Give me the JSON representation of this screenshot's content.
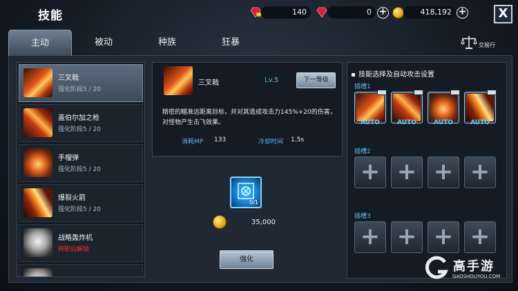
{
  "header": {
    "title": "技能",
    "resources": [
      {
        "icon": "locked-ruby-icon",
        "value": "140"
      },
      {
        "icon": "ruby-icon",
        "value": "0"
      },
      {
        "icon": "gold-coin-icon",
        "value": "418,192"
      }
    ],
    "close_label": "X"
  },
  "tabs": [
    {
      "label": "主动",
      "active": true
    },
    {
      "label": "被动",
      "active": false
    },
    {
      "label": "种族",
      "active": false
    },
    {
      "label": "狂暴",
      "active": false
    }
  ],
  "trade": {
    "label": "交易行",
    "icon": "scales-icon"
  },
  "skills": [
    {
      "name": "三叉戟",
      "stage": "强化阶段5 / 20",
      "icon": "trident-skill-icon",
      "selected": true
    },
    {
      "name": "盖伯尔加之枪",
      "stage": "强化阶段5 / 20",
      "icon": "spear-skill-icon",
      "selected": false
    },
    {
      "name": "手榴弹",
      "stage": "强化阶段5 / 20",
      "icon": "grenade-skill-icon",
      "selected": false
    },
    {
      "name": "爆裂火箭",
      "stage": "强化阶段5 / 20",
      "icon": "rocket-skill-icon",
      "selected": false
    },
    {
      "name": "战略轰炸机",
      "stage": "转职后解锁",
      "icon": "bomber-skill-icon",
      "selected": false
    }
  ],
  "detail": {
    "name": "三叉戟",
    "level": "Lv.5",
    "next_button": "下一等级",
    "description": "精密的瞄准远距离目标，并对其造成攻击力145%+20的伤害，对怪物产生击飞效果。",
    "mp_label": "消耗MP",
    "mp_value": "133",
    "cooldown_label": "冷却时间",
    "cooldown_value": "1.5s"
  },
  "upgrade": {
    "material_count": "0/1",
    "cost": "35,000",
    "button": "强化"
  },
  "slots_panel": {
    "title": "技能选择及自动攻击设置",
    "groups": [
      {
        "label": "插槽1",
        "slots": [
          {
            "filled": true,
            "auto": "AUTO"
          },
          {
            "filled": true,
            "auto": "AUTO"
          },
          {
            "filled": true,
            "auto": "AUTO"
          },
          {
            "filled": true,
            "auto": "AUTO"
          }
        ]
      },
      {
        "label": "插槽2",
        "slots": [
          {
            "filled": false
          },
          {
            "filled": false
          },
          {
            "filled": false
          },
          {
            "filled": false
          }
        ]
      },
      {
        "label": "插槽3",
        "slots": [
          {
            "filled": false
          },
          {
            "filled": false
          },
          {
            "filled": false
          },
          {
            "filled": false
          }
        ]
      }
    ]
  },
  "watermark": {
    "brand": "高手游",
    "domain": "GAOSHOUYOU.COM"
  },
  "colors": {
    "accent_blue": "#5fb7e8",
    "locked_red": "#ff2b2b",
    "gold": "#e4a514"
  }
}
